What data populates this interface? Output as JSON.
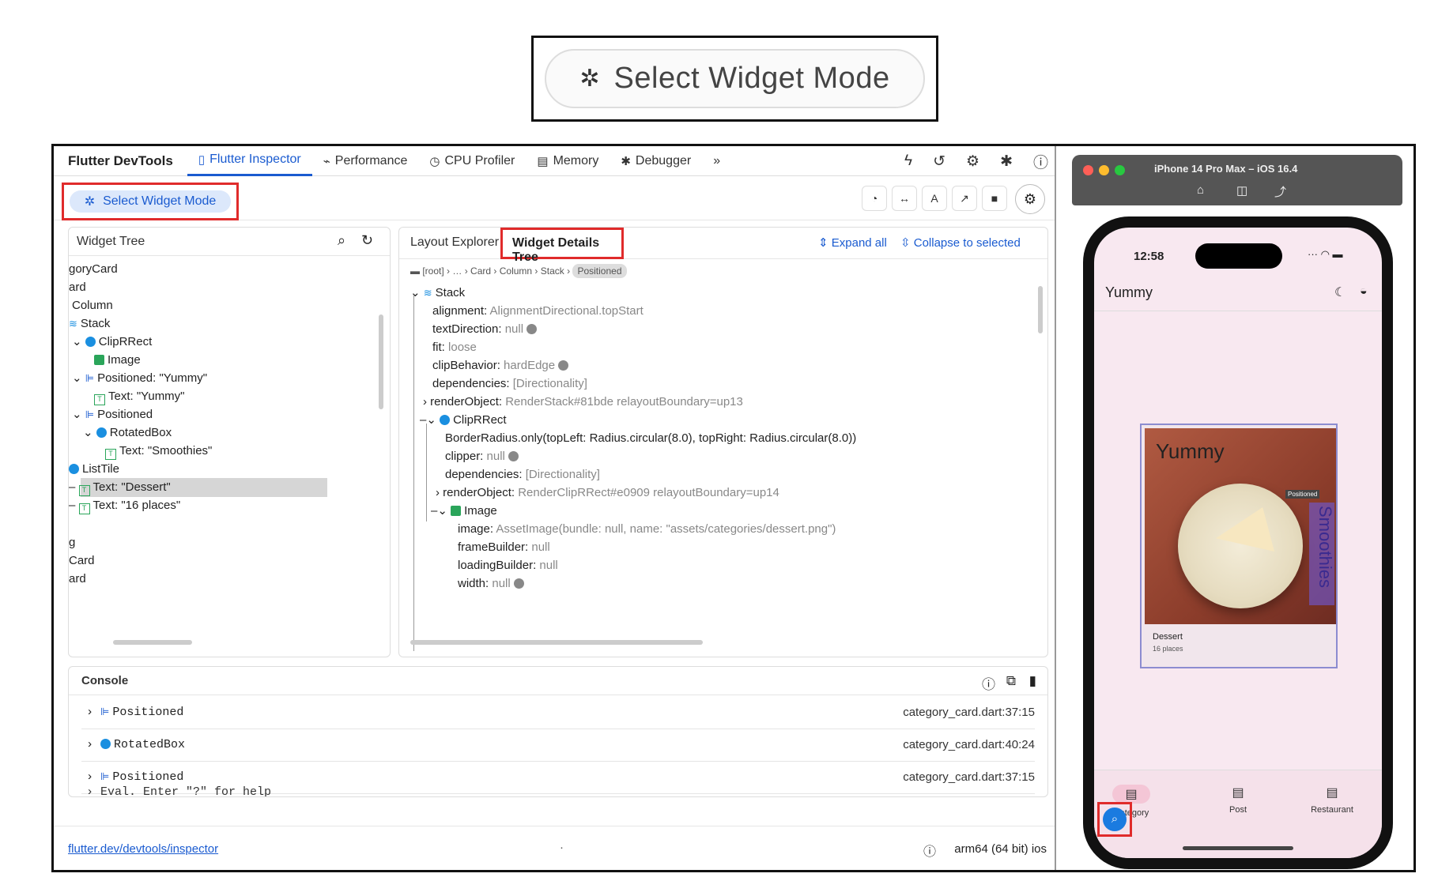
{
  "callout": {
    "label": "Select Widget Mode",
    "icon": "pointer-sparkle-icon"
  },
  "devtools": {
    "brand": "Flutter DevTools",
    "tabs": [
      {
        "label": "Flutter Inspector",
        "icon": "phone-icon"
      },
      {
        "label": "Performance",
        "icon": "pulse-icon"
      },
      {
        "label": "CPU Profiler",
        "icon": "clock-icon"
      },
      {
        "label": "Memory",
        "icon": "memory-icon"
      },
      {
        "label": "Debugger",
        "icon": "bug-icon"
      },
      {
        "label": "»"
      }
    ],
    "select_mode_label": "Select Widget Mode",
    "widget_tree": {
      "title": "Widget Tree",
      "rows": [
        "goryCard",
        "ard",
        "Column",
        "Stack",
        "ClipRRect",
        "Image",
        "Positioned: \"Yummy\"",
        "Text: \"Yummy\"",
        "Positioned",
        "RotatedBox",
        "Text: \"Smoothies\"",
        "ListTile",
        "Text: \"Dessert\"",
        "Text: \"16 places\"",
        "g",
        "Card",
        "ard"
      ]
    },
    "details": {
      "tab_layout": "Layout Explorer",
      "tab_details": "Widget Details Tree",
      "expand_all": "Expand all",
      "collapse": "Collapse to selected",
      "crumbs": [
        "[root]",
        "…",
        "Card",
        "Column",
        "Stack",
        "Positioned"
      ],
      "lines": [
        {
          "k": "Stack",
          "v": ""
        },
        {
          "k": "alignment: ",
          "v": "AlignmentDirectional.topStart"
        },
        {
          "k": "textDirection: ",
          "v": "null"
        },
        {
          "k": "fit: ",
          "v": "loose"
        },
        {
          "k": "clipBehavior: ",
          "v": "hardEdge"
        },
        {
          "k": "dependencies: ",
          "v": "[Directionality]"
        },
        {
          "k": "renderObject: ",
          "v": "RenderStack#81bde relayoutBoundary=up13"
        },
        {
          "k": "ClipRRect",
          "v": ""
        },
        {
          "k": "BorderRadius.only(topLeft: Radius.circular(8.0), topRight: Radius.circular(8.0))",
          "v": ""
        },
        {
          "k": "clipper: ",
          "v": "null"
        },
        {
          "k": "dependencies: ",
          "v": "[Directionality]"
        },
        {
          "k": "renderObject: ",
          "v": "RenderClipRRect#e0909 relayoutBoundary=up14"
        },
        {
          "k": "Image",
          "v": ""
        },
        {
          "k": "image: ",
          "v": "AssetImage(bundle: null, name: \"assets/categories/dessert.png\")"
        },
        {
          "k": "frameBuilder: ",
          "v": "null"
        },
        {
          "k": "loadingBuilder: ",
          "v": "null"
        },
        {
          "k": "width: ",
          "v": "null"
        }
      ]
    },
    "console": {
      "title": "Console",
      "rows": [
        {
          "name": "Positioned",
          "loc": "category_card.dart:37:15"
        },
        {
          "name": "RotatedBox",
          "loc": "category_card.dart:40:24"
        },
        {
          "name": "Positioned",
          "loc": "category_card.dart:37:15"
        }
      ],
      "eval": "Eval. Enter \"?\" for help"
    },
    "footer": {
      "link": "flutter.dev/devtools/inspector",
      "dot": "·",
      "arch": "arm64 (64 bit) ios"
    }
  },
  "simulator": {
    "title": "iPhone 14 Pro Max – iOS 16.4",
    "time": "12:58",
    "app_title": "Yummy",
    "card_title": "Yummy",
    "positioned_tag": "Positioned",
    "rotated_text": "Smoothies",
    "card_line1": "Dessert",
    "card_line2": "16 places",
    "nav": [
      "Category",
      "Post",
      "Restaurant"
    ]
  }
}
